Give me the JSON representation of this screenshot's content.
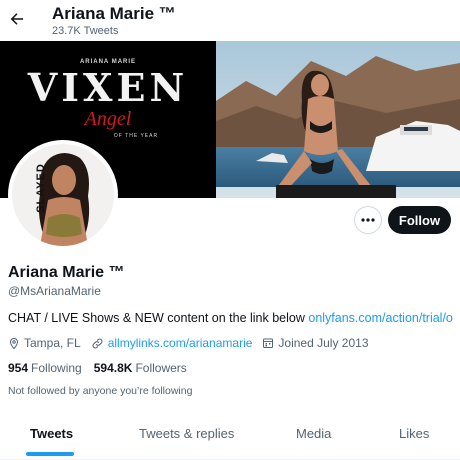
{
  "header": {
    "back_icon": "arrow-left-icon",
    "name": "Ariana Marie ™",
    "tweet_count": "23.7K Tweets"
  },
  "banner": {
    "brand_small": "ARIANA MARIE",
    "brand_big": "VIXEN",
    "award": "Angel",
    "award_sub": "OF THE YEAR"
  },
  "avatar": {
    "caption": "SLAYED"
  },
  "actions": {
    "more_icon": "more-dots-icon",
    "follow_label": "Follow"
  },
  "profile": {
    "name": "Ariana Marie ™",
    "handle": "@MsArianaMarie",
    "bio_text": "CHAT / LIVE Shows & NEW content on the link below ",
    "bio_link": "onlyfans.com/action/trial/o...",
    "location": "Tampa, FL",
    "website": "allmylinks.com/arianamarie",
    "joined": "Joined July 2013",
    "following_count": "954",
    "following_label": "Following",
    "followers_count": "594.8K",
    "followers_label": "Followers",
    "followed_note": "Not followed by anyone you’re following"
  },
  "tabs": [
    {
      "label": "Tweets",
      "active": true
    },
    {
      "label": "Tweets & replies",
      "active": false
    },
    {
      "label": "Media",
      "active": false
    },
    {
      "label": "Likes",
      "active": false
    }
  ],
  "colors": {
    "accent": "#1d9bf0",
    "text": "#0f1419",
    "muted": "#536471"
  }
}
